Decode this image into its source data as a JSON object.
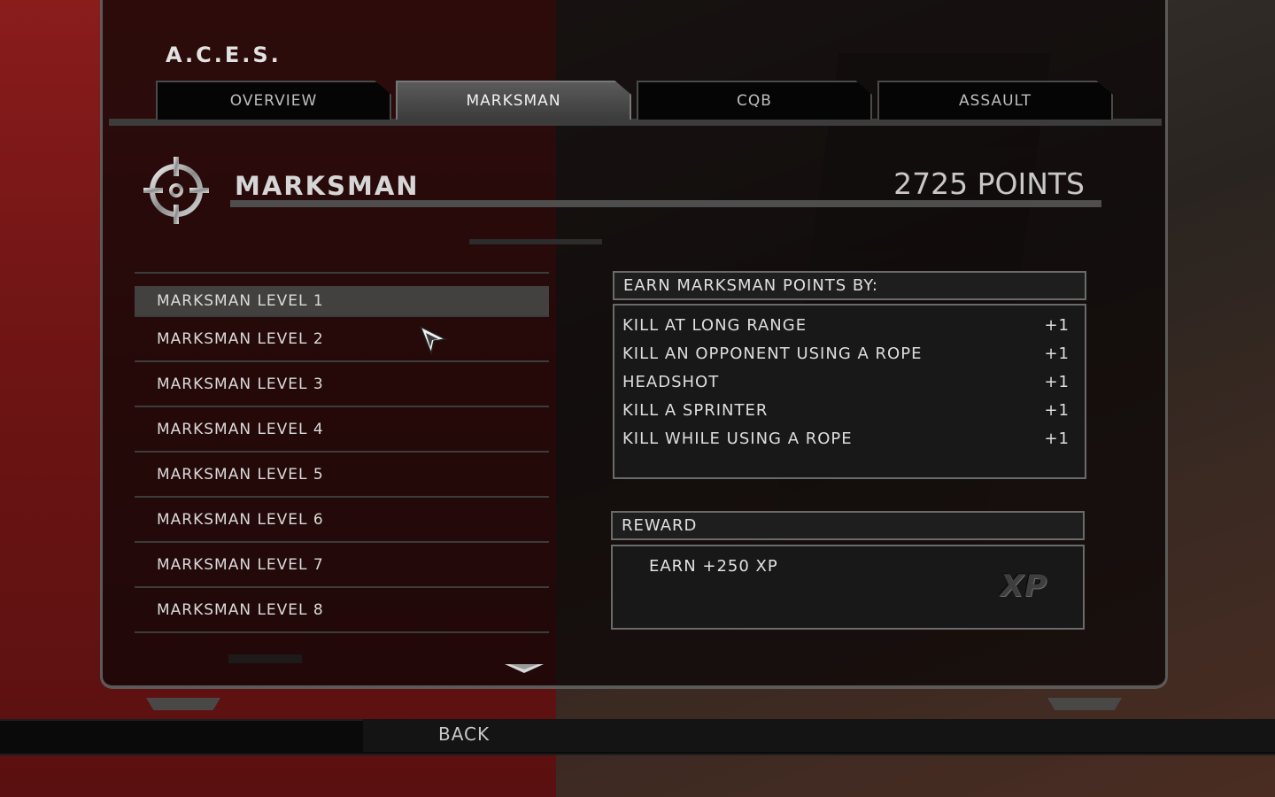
{
  "app": {
    "title": "A.C.E.S."
  },
  "tabs": [
    {
      "label": "OVERVIEW",
      "active": false
    },
    {
      "label": "MARKSMAN",
      "active": true
    },
    {
      "label": "CQB",
      "active": false
    },
    {
      "label": "ASSAULT",
      "active": false
    }
  ],
  "section": {
    "icon": "crosshair-icon",
    "title": "MARKSMAN",
    "points": "2725 POINTS"
  },
  "levels": [
    {
      "label": "MARKSMAN LEVEL 1",
      "selected": true
    },
    {
      "label": "MARKSMAN LEVEL 2",
      "selected": false
    },
    {
      "label": "MARKSMAN LEVEL 3",
      "selected": false
    },
    {
      "label": "MARKSMAN LEVEL 4",
      "selected": false
    },
    {
      "label": "MARKSMAN LEVEL 5",
      "selected": false
    },
    {
      "label": "MARKSMAN LEVEL 6",
      "selected": false
    },
    {
      "label": "MARKSMAN LEVEL 7",
      "selected": false
    },
    {
      "label": "MARKSMAN LEVEL 8",
      "selected": false
    }
  ],
  "earn": {
    "header": "EARN MARKSMAN POINTS BY:",
    "rows": [
      {
        "label": "KILL AT LONG RANGE",
        "value": "+1"
      },
      {
        "label": "KILL AN OPPONENT USING A ROPE",
        "value": "+1"
      },
      {
        "label": "HEADSHOT",
        "value": "+1"
      },
      {
        "label": "KILL A SPRINTER",
        "value": "+1"
      },
      {
        "label": "KILL WHILE USING A ROPE",
        "value": "+1"
      }
    ]
  },
  "reward": {
    "header": "REWARD",
    "text": "EARN +250 XP",
    "badge": "XP"
  },
  "footer": {
    "back_label": "BACK"
  },
  "colors": {
    "accent_red": "#8a1c1c",
    "panel_border": "#5c5a58"
  }
}
